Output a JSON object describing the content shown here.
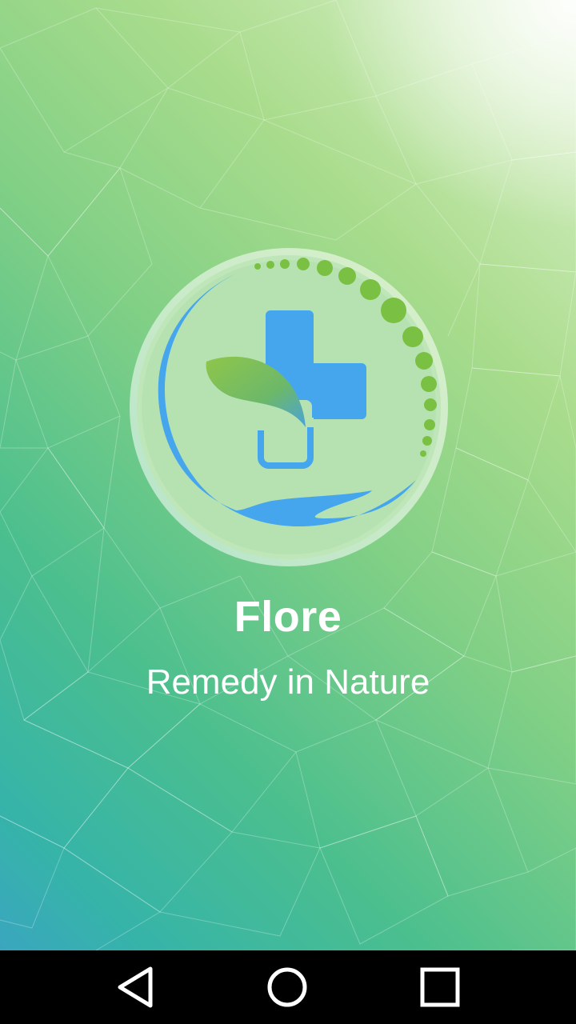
{
  "app": {
    "name": "Flore",
    "tagline": "Remedy in Nature"
  },
  "logo": {
    "icon": "hand-leaf-cross-logo",
    "colors": {
      "blue": "#45a6ee",
      "green": "#7ac143",
      "ring": "#bfe6b8"
    }
  },
  "navigation_bar": {
    "back": {
      "icon": "back-triangle-icon"
    },
    "home": {
      "icon": "home-circle-icon"
    },
    "recents": {
      "icon": "recents-square-icon"
    }
  },
  "colors": {
    "background_start": "#dff2cf",
    "background_end": "#3aa6bf",
    "text": "#ffffff",
    "navbar": "#000000"
  }
}
